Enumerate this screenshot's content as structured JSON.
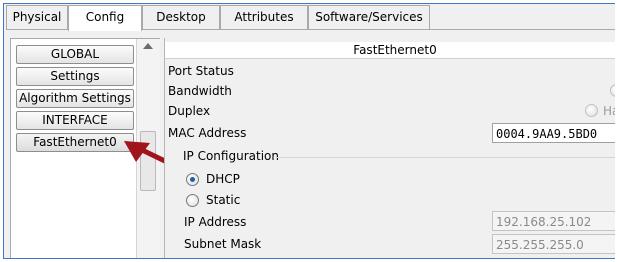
{
  "tabs": [
    {
      "label": "Physical"
    },
    {
      "label": "Config"
    },
    {
      "label": "Desktop"
    },
    {
      "label": "Attributes"
    },
    {
      "label": "Software/Services"
    }
  ],
  "active_tab": "Config",
  "sidebar": {
    "items": [
      {
        "label": "GLOBAL",
        "kind": "button"
      },
      {
        "label": "Settings",
        "kind": "button"
      },
      {
        "label": "Algorithm Settings",
        "kind": "button"
      },
      {
        "label": "INTERFACE",
        "kind": "button"
      },
      {
        "label": "FastEthernet0",
        "kind": "button",
        "selected": true
      }
    ]
  },
  "panel": {
    "title": "FastEthernet0",
    "port_status_label": "Port Status",
    "bandwidth_label": "Bandwidth",
    "duplex_label": "Duplex",
    "duplex_option_partial": "Ha",
    "mac_label": "MAC Address",
    "mac_value": "0004.9AA9.5BD0",
    "ip_config_label": "IP Configuration",
    "dhcp_label": "DHCP",
    "static_label": "Static",
    "ip_address_label": "IP Address",
    "ip_address_value": "192.168.25.102",
    "subnet_mask_label": "Subnet Mask",
    "subnet_mask_value": "255.255.255.0",
    "ip_mode": "DHCP"
  },
  "colors": {
    "annotation_arrow": "#a0141c",
    "window_border": "#3a78c8",
    "radio_dot": "#1f5ea8"
  }
}
